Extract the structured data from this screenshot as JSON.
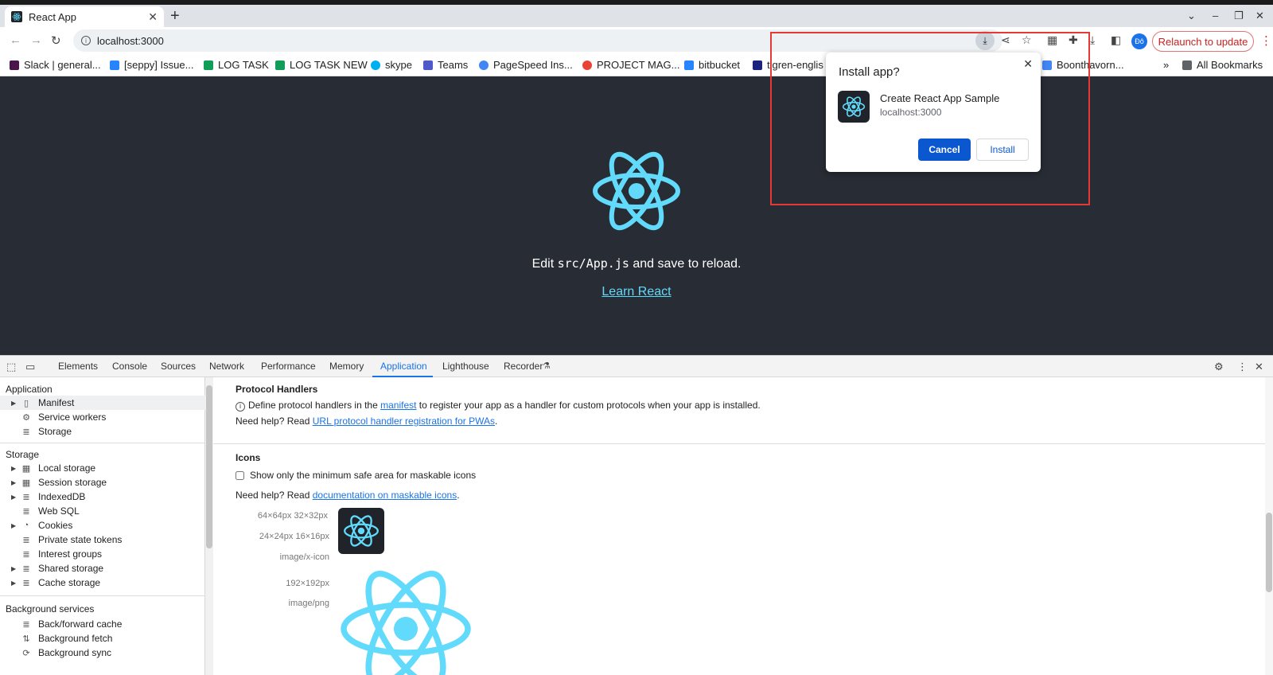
{
  "browser": {
    "tab_title": "React App",
    "tab_close": "✕",
    "new_tab": "+",
    "url": "localhost:3000",
    "relaunch_label": "Relaunch to update",
    "avatar_initials": "Đô"
  },
  "bookmarks": {
    "items": [
      {
        "label": "Slack | general...",
        "color": "#4a154b"
      },
      {
        "label": "[seppy] Issue...",
        "color": "#2684ff"
      },
      {
        "label": "LOG TASK",
        "color": "#0f9d58"
      },
      {
        "label": "LOG TASK NEW",
        "color": "#0f9d58"
      },
      {
        "label": "skype",
        "color": "#00aff0"
      },
      {
        "label": "Teams",
        "color": "#5059c9"
      },
      {
        "label": "PageSpeed Ins...",
        "color": "#4285f4"
      },
      {
        "label": "PROJECT MAG...",
        "color": "#ea4335"
      },
      {
        "label": "bitbucket",
        "color": "#2684ff"
      },
      {
        "label": "tigren-englis",
        "color": "#1a237e"
      },
      {
        "label": "Boonthavorn...",
        "color": "#4285f4"
      }
    ],
    "overflow": "»",
    "all_bookmarks": "All Bookmarks"
  },
  "page": {
    "edit_prefix": "Edit ",
    "edit_code": "src/App.js",
    "edit_suffix": " and save to reload.",
    "learn_link": "Learn React",
    "bg_color": "#282c34",
    "accent_color": "#61dafb"
  },
  "install_popup": {
    "title": "Install app?",
    "close": "✕",
    "app_name": "Create React App Sample",
    "app_host": "localhost:3000",
    "cancel_label": "Cancel",
    "install_label": "Install"
  },
  "devtools": {
    "tabs": [
      "Elements",
      "Console",
      "Sources",
      "Network",
      "Performance",
      "Memory",
      "Application",
      "Lighthouse",
      "Recorder"
    ],
    "active_tab": "Application",
    "sidebar": {
      "application_header": "Application",
      "application_items": [
        "Manifest",
        "Service workers",
        "Storage"
      ],
      "storage_header": "Storage",
      "storage_items": [
        "Local storage",
        "Session storage",
        "IndexedDB",
        "Web SQL",
        "Cookies",
        "Private state tokens",
        "Interest groups",
        "Shared storage",
        "Cache storage"
      ],
      "background_header": "Background services",
      "background_items": [
        "Back/forward cache",
        "Background fetch",
        "Background sync"
      ]
    },
    "main": {
      "protocol_heading": "Protocol Handlers",
      "protocol_text_1": "Define protocol handlers in the ",
      "protocol_link_1": "manifest",
      "protocol_text_2": " to register your app as a handler for custom protocols when your app is installed.",
      "help_prefix": "Need help? Read ",
      "protocol_help_link": "URL protocol handler registration for PWAs",
      "period": ".",
      "icons_heading": "Icons",
      "maskable_checkbox": "Show only the minimum safe area for maskable icons",
      "icons_help_link": "documentation on maskable icons",
      "icon1_sizes_a": "64×64px 32×32px",
      "icon1_sizes_b": "24×24px 16×16px",
      "icon1_type": "image/x-icon",
      "icon2_size": "192×192px",
      "icon2_type": "image/png"
    }
  }
}
